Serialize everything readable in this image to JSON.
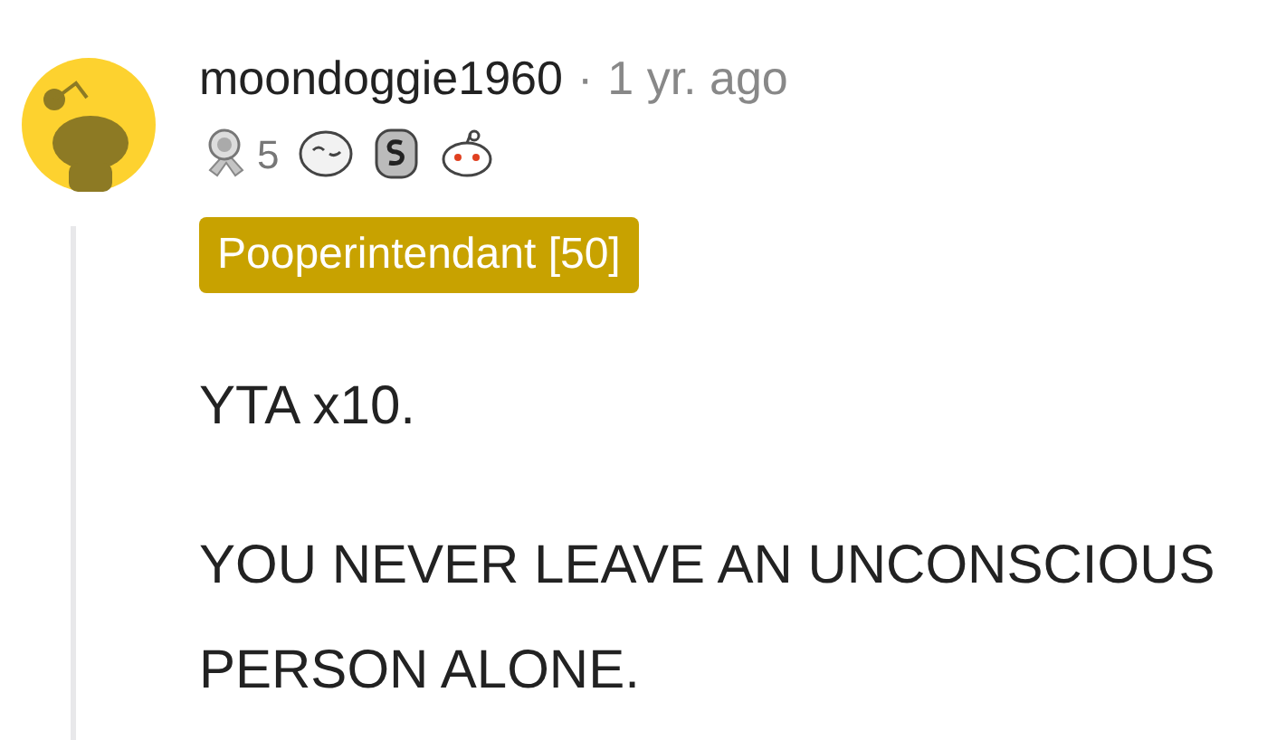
{
  "comment": {
    "username": "moondoggie1960",
    "separator": "·",
    "time": "1 yr. ago",
    "awards": [
      {
        "kind": "silver",
        "count": "5"
      },
      {
        "kind": "face"
      },
      {
        "kind": "coin"
      },
      {
        "kind": "snoo"
      }
    ],
    "flair": {
      "text": "Pooperintendant [50]",
      "color": "#c8a200"
    },
    "paragraphs": [
      "YTA x10.",
      "YOU NEVER LEAVE AN UNCONSCIOUS PERSON ALONE."
    ]
  }
}
